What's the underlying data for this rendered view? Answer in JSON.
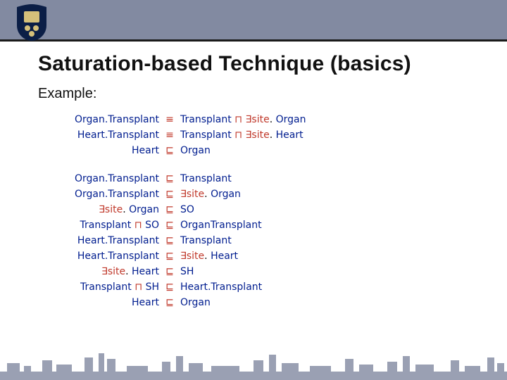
{
  "title": "Saturation-based Technique (basics)",
  "example_label": "Example:",
  "symbols": {
    "equiv": "≡",
    "sub": "⊑",
    "and": "⊓",
    "exists": "∃"
  },
  "concepts": {
    "OrganTransplant": "Organ.Transplant",
    "HeartTransplant": "Heart.Transplant",
    "Transplant": "Transplant",
    "Organ": "Organ",
    "Heart": "Heart",
    "SO": "SO",
    "SH": "SH",
    "OrganTransplant2": "OrganTransplant"
  },
  "roles": {
    "site": "site"
  },
  "groups": [
    [
      {
        "lhs": [
          {
            "k": "concept",
            "v": "OrganTransplant"
          }
        ],
        "op": "equiv",
        "rhs": [
          {
            "k": "concept",
            "v": "Transplant"
          },
          {
            "k": "op",
            "v": "and"
          },
          {
            "k": "exists"
          },
          {
            "k": "role",
            "v": "site"
          },
          {
            "k": "dot"
          },
          {
            "k": "concept",
            "v": "Organ"
          }
        ]
      },
      {
        "lhs": [
          {
            "k": "concept",
            "v": "HeartTransplant"
          }
        ],
        "op": "equiv",
        "rhs": [
          {
            "k": "concept",
            "v": "Transplant"
          },
          {
            "k": "op",
            "v": "and"
          },
          {
            "k": "exists"
          },
          {
            "k": "role",
            "v": "site"
          },
          {
            "k": "dot"
          },
          {
            "k": "concept",
            "v": "Heart"
          }
        ]
      },
      {
        "lhs": [
          {
            "k": "concept",
            "v": "Heart"
          }
        ],
        "op": "sub",
        "rhs": [
          {
            "k": "concept",
            "v": "Organ"
          }
        ]
      }
    ],
    [
      {
        "lhs": [
          {
            "k": "concept",
            "v": "OrganTransplant"
          }
        ],
        "op": "sub",
        "rhs": [
          {
            "k": "concept",
            "v": "Transplant"
          }
        ]
      },
      {
        "lhs": [
          {
            "k": "concept",
            "v": "OrganTransplant"
          }
        ],
        "op": "sub",
        "rhs": [
          {
            "k": "exists"
          },
          {
            "k": "role",
            "v": "site"
          },
          {
            "k": "dot"
          },
          {
            "k": "concept",
            "v": "Organ"
          }
        ]
      },
      {
        "lhs": [
          {
            "k": "exists"
          },
          {
            "k": "role",
            "v": "site"
          },
          {
            "k": "dot"
          },
          {
            "k": "concept",
            "v": "Organ"
          }
        ],
        "op": "sub",
        "rhs": [
          {
            "k": "concept",
            "v": "SO"
          }
        ]
      },
      {
        "lhs": [
          {
            "k": "concept",
            "v": "Transplant"
          },
          {
            "k": "op",
            "v": "and"
          },
          {
            "k": "concept",
            "v": "SO"
          }
        ],
        "op": "sub",
        "rhs": [
          {
            "k": "concept",
            "v": "OrganTransplant2"
          }
        ]
      },
      {
        "lhs": [
          {
            "k": "concept",
            "v": "HeartTransplant"
          }
        ],
        "op": "sub",
        "rhs": [
          {
            "k": "concept",
            "v": "Transplant"
          }
        ]
      },
      {
        "lhs": [
          {
            "k": "concept",
            "v": "HeartTransplant"
          }
        ],
        "op": "sub",
        "rhs": [
          {
            "k": "exists"
          },
          {
            "k": "role",
            "v": "site"
          },
          {
            "k": "dot"
          },
          {
            "k": "concept",
            "v": "Heart"
          }
        ]
      },
      {
        "lhs": [
          {
            "k": "exists"
          },
          {
            "k": "role",
            "v": "site"
          },
          {
            "k": "dot"
          },
          {
            "k": "concept",
            "v": "Heart"
          }
        ],
        "op": "sub",
        "rhs": [
          {
            "k": "concept",
            "v": "SH"
          }
        ]
      },
      {
        "lhs": [
          {
            "k": "concept",
            "v": "Transplant"
          },
          {
            "k": "op",
            "v": "and"
          },
          {
            "k": "concept",
            "v": "SH"
          }
        ],
        "op": "sub",
        "rhs": [
          {
            "k": "concept",
            "v": "HeartTransplant"
          }
        ]
      },
      {
        "lhs": [
          {
            "k": "concept",
            "v": "Heart"
          }
        ],
        "op": "sub",
        "rhs": [
          {
            "k": "concept",
            "v": "Organ"
          }
        ]
      }
    ]
  ]
}
